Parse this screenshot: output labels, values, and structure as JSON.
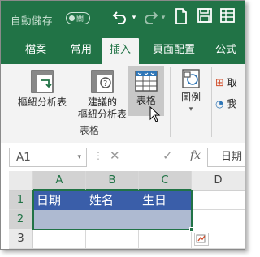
{
  "titlebar": {
    "autosave_label": "自動儲存",
    "autosave_state": "關",
    "icons": [
      "undo-icon",
      "redo-icon",
      "new-file-icon",
      "save-icon",
      "table-icon"
    ]
  },
  "tabs": [
    {
      "label": "檔案"
    },
    {
      "label": "常用"
    },
    {
      "label": "插入",
      "active": true
    },
    {
      "label": "頁面配置"
    },
    {
      "label": "公式"
    }
  ],
  "ribbon": {
    "pivot_table": "樞紐分析表",
    "recommended_pivot_line1": "建議的",
    "recommended_pivot_line2": "樞紐分析表",
    "table": "表格",
    "group_tables": "表格",
    "illustrations": "圖例",
    "addins_1": "取",
    "addins_2": "我"
  },
  "formula_bar": {
    "name_box": "A1",
    "fx": "fx",
    "value": "日期"
  },
  "grid": {
    "columns": [
      "A",
      "B",
      "C",
      "D"
    ],
    "rows": [
      "1",
      "2",
      "3"
    ],
    "cells": {
      "A1": "日期",
      "B1": "姓名",
      "C1": "生日"
    }
  },
  "colors": {
    "brand_green": "#217346",
    "table_header": "#3a5ea9",
    "table_band": "#aebad1"
  }
}
